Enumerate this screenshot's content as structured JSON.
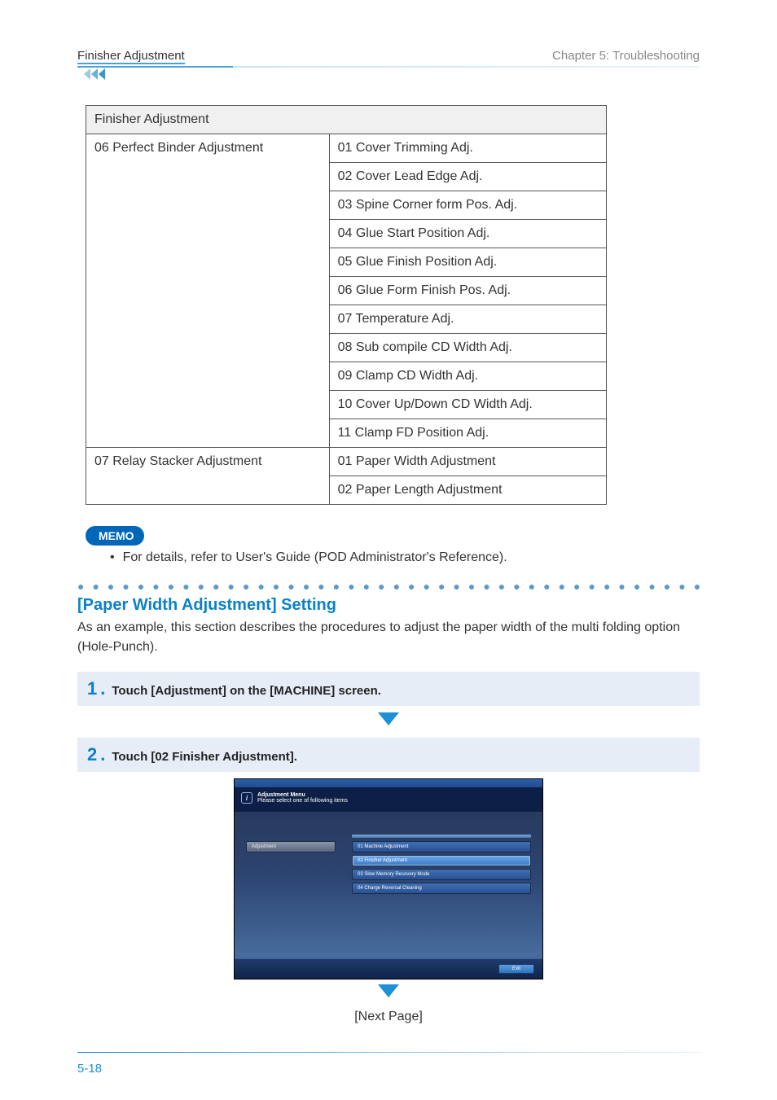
{
  "header": {
    "left": "Finisher Adjustment",
    "right": "Chapter 5: Troubleshooting"
  },
  "table": {
    "title": "Finisher Adjustment",
    "groups": [
      {
        "left": "06 Perfect Binder Adjustment",
        "rows": [
          "01 Cover Trimming Adj.",
          "02 Cover Lead Edge Adj.",
          "03 Spine Corner form Pos. Adj.",
          "04 Glue Start Position Adj.",
          "05 Glue Finish Position Adj.",
          "06 Glue Form Finish Pos. Adj.",
          "07 Temperature Adj.",
          "08 Sub compile CD Width Adj.",
          "09 Clamp CD Width Adj.",
          "10 Cover Up/Down CD Width Adj.",
          "11 Clamp FD Position Adj."
        ]
      },
      {
        "left": "07 Relay Stacker Adjustment",
        "rows": [
          "01 Paper Width Adjustment",
          "02 Paper Length Adjustment"
        ]
      }
    ]
  },
  "memo": {
    "badge": "MEMO",
    "bullet_marker": "•",
    "bullet": "For details, refer to User's Guide (POD Administrator's Reference)."
  },
  "section": {
    "title": "[Paper Width Adjustment] Setting",
    "desc": "As an example, this section describes the procedures to adjust the paper width of the multi folding option (Hole-Punch)."
  },
  "steps": [
    {
      "num": "1",
      "text": "Touch [Adjustment] on the [MACHINE] screen."
    },
    {
      "num": "2",
      "text": "Touch [02 Finisher Adjustment]."
    }
  ],
  "screenshot": {
    "title1": "Adjustment Menu",
    "title2": "Please select one of following items",
    "left_button": "Adjustment",
    "right_buttons": [
      "01 Machine Adjustment",
      "02 Finisher Adjustment",
      "03 Slow Memory Recovery Mode",
      "04 Charge Reversal Cleaning"
    ],
    "exit": "Exit"
  },
  "next_page": "[Next Page]",
  "page_number": "5-18"
}
